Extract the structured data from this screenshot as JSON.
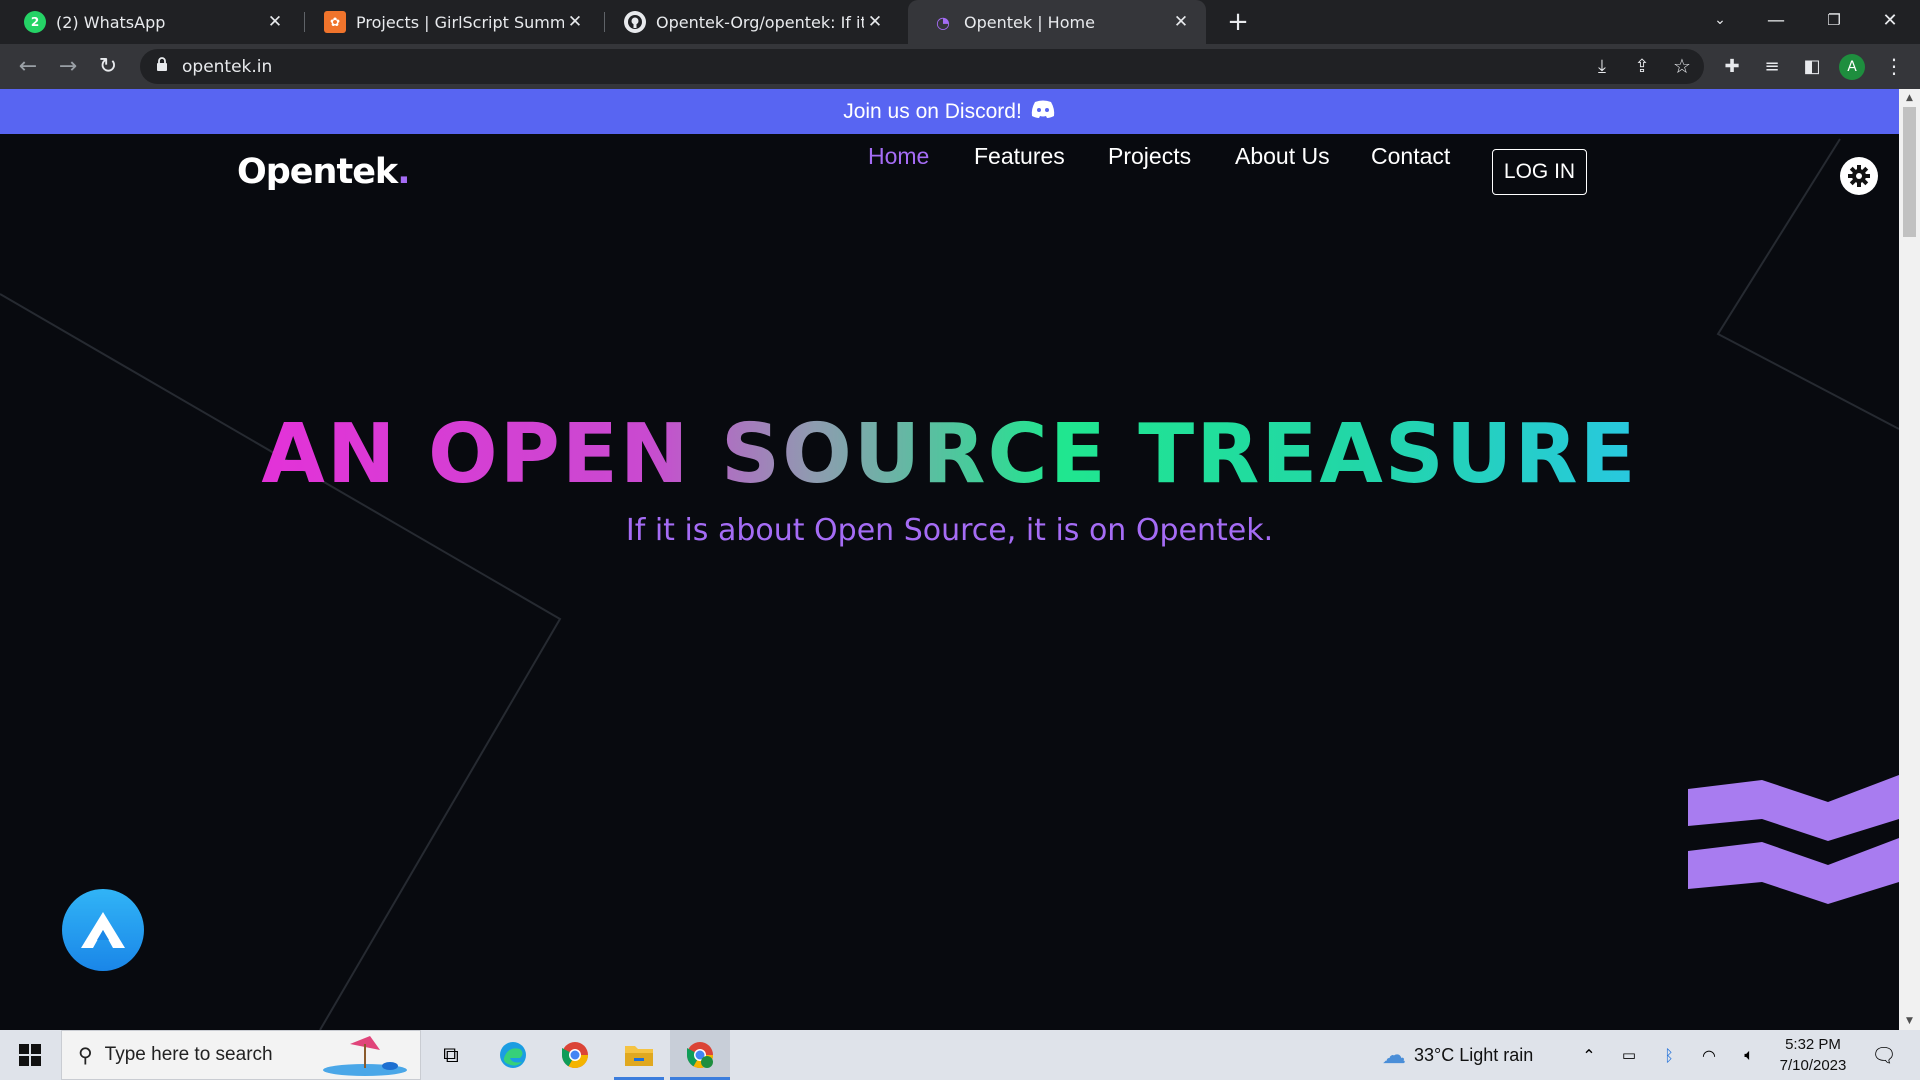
{
  "browser": {
    "tabs": [
      {
        "title": "(2) WhatsApp",
        "active": false,
        "icon": "whatsapp-icon"
      },
      {
        "title": "Projects | GirlScript Summer of Code",
        "active": false,
        "icon": "girlscript-icon"
      },
      {
        "title": "Opentek-Org/opentek: If it is about Open Source",
        "active": false,
        "icon": "github-icon"
      },
      {
        "title": "Opentek | Home",
        "active": true,
        "icon": "opentek-icon"
      }
    ],
    "url": "opentek.in",
    "profile_initial": "A"
  },
  "page": {
    "banner_text": "Join us on Discord!",
    "logo_text": "Opentek",
    "logo_dot": ".",
    "nav": [
      "Home",
      "Features",
      "Projects",
      "About Us",
      "Contact"
    ],
    "login_label": "LOG IN",
    "hero_title": "AN OPEN SOURCE TREASURE",
    "hero_subtitle": "If it is about Open Source, it is on Opentek.",
    "colors": {
      "background": "#080a0f",
      "banner": "#5865f2",
      "accent": "#a56cf5",
      "gradient_start": "#e332d8",
      "gradient_end": "#28c8e0"
    }
  },
  "taskbar": {
    "search_placeholder": "Type here to search",
    "weather": "33°C  Light rain",
    "time": "5:32 PM",
    "date": "7/10/2023"
  }
}
